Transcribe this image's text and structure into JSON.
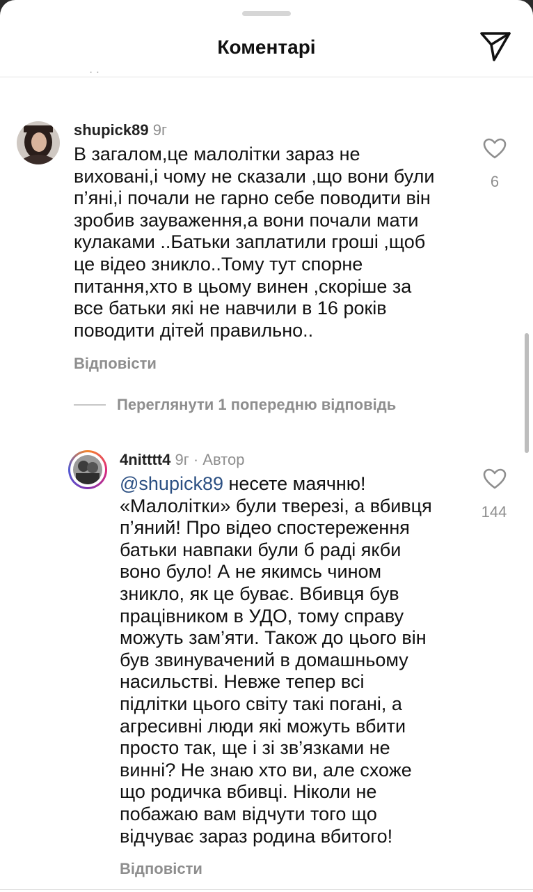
{
  "header": {
    "title": "Коментарі",
    "send_icon": "send-paper-plane-icon"
  },
  "comments": [
    {
      "username": "shupick89",
      "time": "9г",
      "author_badge": "",
      "lines": [
        "В загалом,це малолітки зараз не",
        "виховані,і чому не сказали ,що вони були",
        "п’яні,і почали не гарно себе поводити він",
        "зробив зауваження,а вони почали мати",
        "кулаками ..Батьки заплатили гроші ,щоб",
        "це відео зникло..Тому тут спорне",
        "питання,хто в цьому винен ,скоріше за",
        "все батьки які не навчили в 16 років",
        "поводити дітей правильно.."
      ],
      "likes": "6",
      "reply_label": "Відповісти"
    },
    {
      "username": "4nitttt4",
      "time": "9г · Автор",
      "mention": "@shupick89",
      "first_line_rest": " несете маячню!",
      "lines": [
        "«Малолітки» були тверезі, а вбивця",
        "п’яний! Про відео спостереження",
        "батьки навпаки були б раді якби",
        "воно було! А не якимсь чином",
        "зникло, як це буває. Вбивця був",
        "працівником в УДО, тому справу",
        "можуть зам’яти. Також до цього він",
        "був звинувачений в домашньому",
        "насильстві. Невже тепер всі",
        "підлітки цього світу такі погані, а",
        "агресивні люди які можуть вбити",
        "просто так, ще і зі зв’язками не",
        "винні? Не знаю хто ви, але схоже",
        "що родичка вбивці. Ніколи не",
        "побажаю вам відчути того що",
        "відчуває зараз родина вбитого!"
      ],
      "likes": "144",
      "reply_label": "Відповісти"
    }
  ],
  "view_replies_label": "Переглянути 1 попередню відповідь",
  "icons": {
    "like": "heart-outline-icon",
    "send": "paper-plane-icon"
  },
  "colors": {
    "mention": "#2b4f82",
    "secondary_text": "#8e8e8e",
    "background": "#ffffff"
  }
}
